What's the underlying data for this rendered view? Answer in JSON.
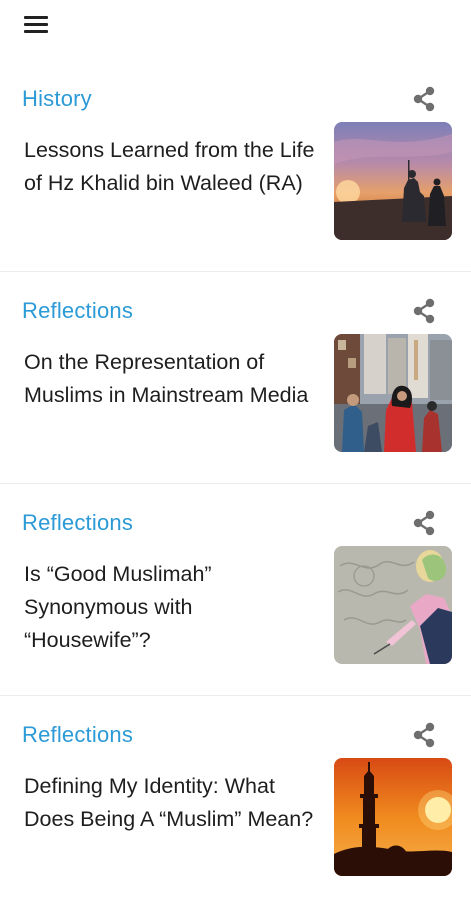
{
  "header": {
    "menu_icon": "hamburger-menu-icon"
  },
  "articles": [
    {
      "category": "History",
      "title": "Lessons Learned from the Life of Hz Khalid bin Waleed (RA)",
      "share_icon": "share-icon",
      "thumbnail": "horsemen-at-sunset-image"
    },
    {
      "category": "Reflections",
      "title": "On the Representation of Muslims in Mainstream Media",
      "share_icon": "share-icon",
      "thumbnail": "women-on-street-image"
    },
    {
      "category": "Reflections",
      "title": "Is “Good Muslimah” Synonymous with “Housewife”?",
      "share_icon": "share-icon",
      "thumbnail": "girl-drawing-in-sand-image"
    },
    {
      "category": "Reflections",
      "title": "Defining My Identity: What Does Being A “Muslim” Mean?",
      "share_icon": "share-icon",
      "thumbnail": "minaret-at-sunset-image"
    }
  ],
  "colors": {
    "category": "#2b9ad6",
    "title": "#1e1e1e",
    "icon": "#6e6e6e",
    "divider": "#ececec"
  }
}
